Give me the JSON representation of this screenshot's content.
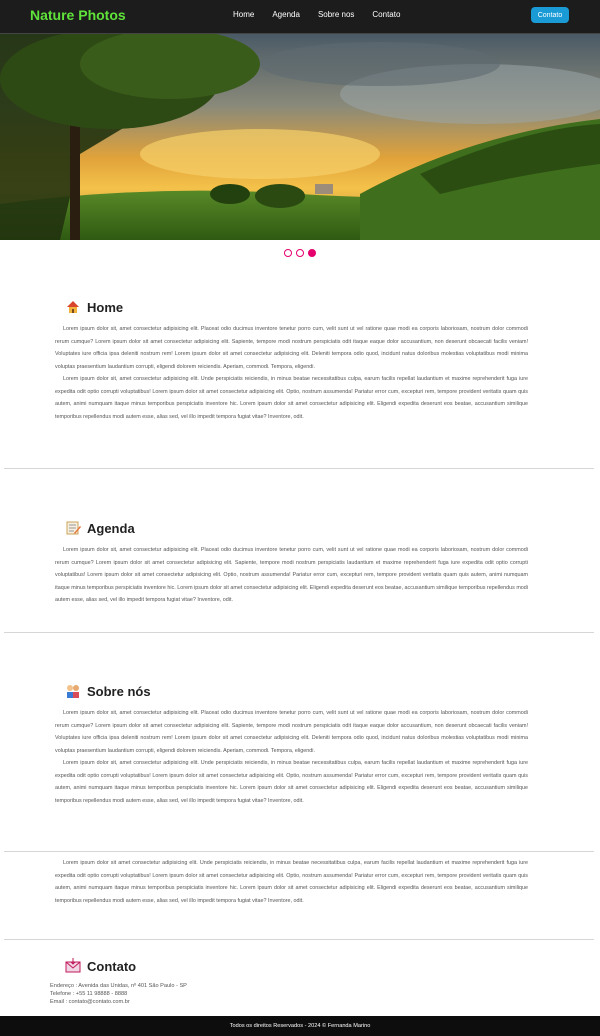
{
  "navbar": {
    "brand": "Nature Photos",
    "links": [
      "Home",
      "Agenda",
      "Sobre nos",
      "Contato"
    ],
    "button_label": "Contato"
  },
  "carousel": {
    "slides": 3,
    "active_index": 2,
    "colors": {
      "dot": "#e6006e"
    }
  },
  "sections": {
    "home": {
      "title": "Home",
      "icon": "house-icon",
      "paragraphs": [
        "Lorem ipsum dolor sit, amet consectetur adipisicing elit. Placeat odio ducimus inventore tenetur porro cum, velit sunt ut vel ratione quae modi ea corporis laboriosam, nostrum dolor commodi rerum cumque? Lorem ipsum dolor sit amet consectetur adipisicing elit. Sapiente, tempore modi nostrum perspiciatis odit itaque eaque dolor accusantium, non deserunt obcaecati facilis veniam! Voluptates iure officia ipsa deleniti nostrum rem! Lorem ipsum dolor sit amet consectetur adipisicing elit. Deleniti tempora odio quod, incidunt natus doloribus molestias voluptatibus modi minima voluptas praesentium laudantium corrupti, eligendi dolorem reiciendis. Aperiam, commodi. Tempora, eligendi.",
        "Lorem ipsum dolor sit, amet consectetur adipisicing elit. Unde perspiciatis reiciendis, in minus beatae necessitatibus culpa, earum facilis repellat laudantium et maxime reprehenderit fuga iure expedita odit optio corrupti voluptatibus! Lorem ipsum dolor sit amet consectetur adipisicing elit. Optio, nostrum assumenda! Pariatur error cum, excepturi rem, tempore provident veritatis quam quis autem, animi numquam itaque minus temporibus perspiciatis inventore hic. Lorem ipsum dolor sit amet consectetur adipisicing elit. Eligendi expedita deserunt eos beatae, accusantium similique temporibus repellendus modi autem esse, alias sed, vel illo impedit tempora fugiat vitae? Inventore, odit."
      ]
    },
    "agenda": {
      "title": "Agenda",
      "icon": "memo-icon",
      "paragraphs": [
        "Lorem ipsum dolor sit, amet consectetur adipisicing elit. Placeat odio ducimus inventore tenetur porro cum, velit sunt ut vel ratione quae modi ea corporis laboriosam, nostrum dolor commodi rerum cumque? Lorem ipsum dolor sit amet consectetur adipisicing elit. Sapiente, tempore modi nostrum perspiciatis laudantium et maxime reprehenderit fuga iure expedita odit optio corrupti voluptatibus! Lorem ipsum dolor sit amet consectetur adipisicing elit. Optio, nostrum assumenda! Pariatur error cum, excepturi rem, tempore provident veritatis quam quis autem, animi numquam itaque minus temporibus perspiciatis inventore hic. Lorem ipsum dolor sit amet consectetur adipisicing elit. Eligendi expedita deserunt eos beatae, accusantium similique temporibus repellendus modi autem esse, alias sed, vel illo impedit tempora fugiat vitae? Inventore, odit."
      ]
    },
    "sobre": {
      "title": "Sobre nós",
      "icon": "people-icon",
      "paragraphs": [
        "Lorem ipsum dolor sit, amet consectetur adipisicing elit. Placeat odio ducimus inventore tenetur porro cum, velit sunt ut vel ratione quae modi ea corporis laboriosam, nostrum dolor commodi rerum cumque? Lorem ipsum dolor sit amet consectetur adipisicing elit. Sapiente, tempore modi nostrum perspiciatis odit itaque eaque dolor accusantium, non deserunt obcaecati facilis veniam! Voluptates iure officia ipsa deleniti nostrum rem! Lorem ipsum dolor sit amet consectetur adipisicing elit. Deleniti tempora odio quod, incidunt natus doloribus molestias voluptatibus modi minima voluptas praesentium laudantium corrupti, eligendi dolorem reiciendis. Aperiam, commodi. Tempora, eligendi.",
        "Lorem ipsum dolor sit, amet consectetur adipisicing elit. Unde perspiciatis reiciendis, in minus beatae necessitatibus culpa, earum facilis repellat laudantium et maxime reprehenderit fuga iure expedita odit optio corrupti voluptatibus! Lorem ipsum dolor sit amet consectetur adipisicing elit. Optio, nostrum assumenda! Pariatur error cum, excepturi rem, tempore provident veritatis quam quis autem, animi numquam itaque minus temporibus perspiciatis inventore hic. Lorem ipsum dolor sit amet consectetur adipisicing elit. Eligendi expedita deserunt eos beatae, accusantium similique temporibus repellendus modi autem esse, alias sed, vel illo impedit tempora fugiat vitae? Inventore, odit."
      ]
    },
    "extra": {
      "paragraphs": [
        "Lorem ipsum dolor sit amet consectetur adipisicing elit. Unde perspiciatis reiciendis, in minus beatae necessitatibus culpa, earum facilis repellat laudantium et maxime reprehenderit fuga iure expedita odit optio corrupti voluptatibus! Lorem ipsum dolor sit amet consectetur adipisicing elit. Optio, nostrum assumenda! Pariatur error cum, excepturi rem, tempore provident veritatis quam quis autem, animi numquam itaque minus temporibus perspiciatis inventore hic. Lorem ipsum dolor sit amet consectetur adipisicing elit. Eligendi expedita deserunt eos beatae, accusantium similique temporibus repellendus modi autem esse, alias sed, vel illo impedit tempora fugiat vitae? Inventore, odit."
      ]
    },
    "contato": {
      "title": "Contato",
      "icon": "envelope-icon",
      "address": "Endereço : Avenida das Unidas, nº 401 São Paulo - SP",
      "phone": "Telefone : +55 11 98888 - 8888",
      "email": "Email : contato@contato.com.br"
    }
  },
  "footer": {
    "text": "Todos os direitos Reservados - 2024 © Fernanda Marino"
  }
}
